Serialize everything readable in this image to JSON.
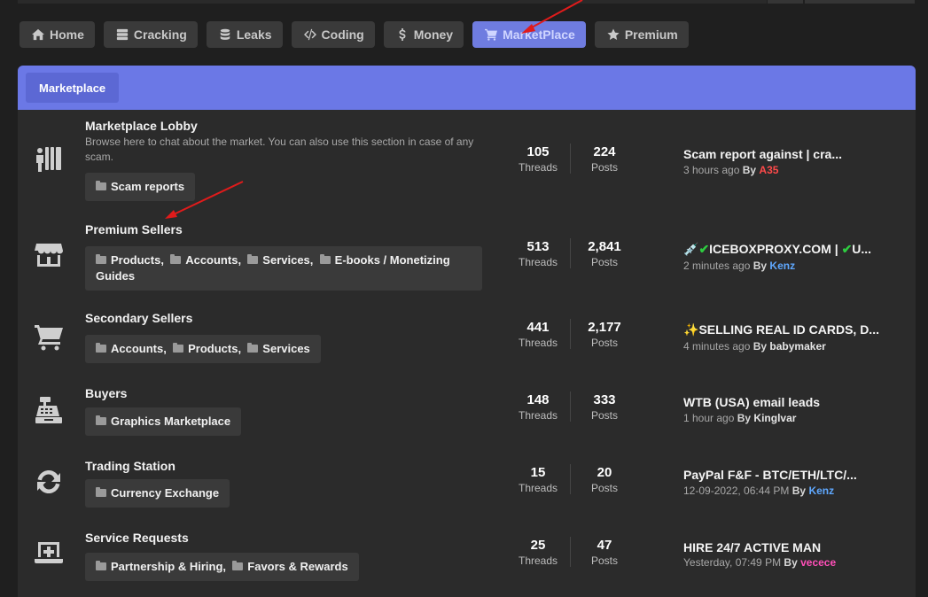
{
  "nav": [
    {
      "label": "Home",
      "icon": "home-icon"
    },
    {
      "label": "Cracking",
      "icon": "server-icon"
    },
    {
      "label": "Leaks",
      "icon": "database-icon"
    },
    {
      "label": "Coding",
      "icon": "code-icon"
    },
    {
      "label": "Money",
      "icon": "dollar-icon"
    },
    {
      "label": "MarketPlace",
      "icon": "cart-icon",
      "active": true
    },
    {
      "label": "Premium",
      "icon": "star-icon"
    }
  ],
  "panel": {
    "tab_label": "Marketplace",
    "accent": "#6b78e6"
  },
  "stat_labels": {
    "threads": "Threads",
    "posts": "Posts"
  },
  "forums": [
    {
      "title": "Marketplace Lobby",
      "icon": "people-chat-icon",
      "description": "Browse here to chat about the market. You can also use this section in case of any scam.",
      "subforums": [
        "Scam reports"
      ],
      "threads": "105",
      "posts": "224",
      "last_title": "Scam report against | cra...",
      "last_time": "3 hours ago",
      "by": "By",
      "last_user": "A35"
    },
    {
      "title": "Premium Sellers",
      "icon": "store-icon",
      "subforums": [
        "Products",
        "Accounts",
        "Services",
        "E-books / Monetizing Guides"
      ],
      "threads": "513",
      "posts": "2,841",
      "last_prefix_icons": [
        "syringe-icon",
        "check-icon"
      ],
      "last_title": "ICEBOXPROXY.COM |",
      "last_title_suffix": "U...",
      "last_time": "2 minutes ago",
      "by": "By",
      "last_user": "Kenz"
    },
    {
      "title": "Secondary Sellers",
      "icon": "cart-icon",
      "subforums": [
        "Accounts",
        "Products",
        "Services"
      ],
      "threads": "441",
      "posts": "2,177",
      "last_prefix_icons": [
        "sparkles-icon"
      ],
      "last_title": "SELLING REAL ID CARDS, D...",
      "last_time": "4 minutes ago",
      "by": "By",
      "last_user": "babymaker"
    },
    {
      "title": "Buyers",
      "icon": "cash-register-icon",
      "subforums": [
        "Graphics Marketplace"
      ],
      "threads": "148",
      "posts": "333",
      "last_title": "WTB (USA) email leads",
      "last_time": "1 hour ago",
      "by": "By",
      "last_user": "Kinglvar"
    },
    {
      "title": "Trading Station",
      "icon": "sync-icon",
      "subforums": [
        "Currency Exchange"
      ],
      "threads": "15",
      "posts": "20",
      "last_title": "PayPal F&F - BTC/ETH/LTC/...",
      "last_time": "12-09-2022, 06:44 PM",
      "by": "By",
      "last_user": "Kenz"
    },
    {
      "title": "Service Requests",
      "icon": "laptop-medical-icon",
      "subforums": [
        "Partnership & Hiring",
        "Favors & Rewards"
      ],
      "threads": "25",
      "posts": "47",
      "last_title": "HIRE 24/7 ACTIVE MAN",
      "last_time": "Yesterday, 07:49 PM",
      "by": "By",
      "last_user": "vecece"
    }
  ]
}
